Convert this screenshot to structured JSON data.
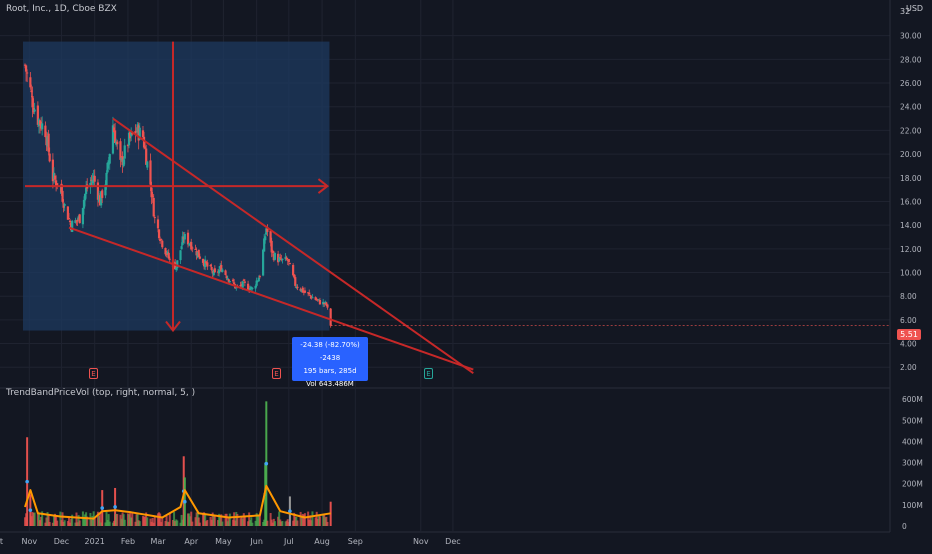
{
  "header": {
    "symbol_title": "Root, Inc., 1D, Cboe BZX",
    "currency": "USD",
    "price_axis_top": "32"
  },
  "indicator": {
    "title": "TrendBandPriceVol (top, right, normal, 5, )"
  },
  "measure_box": {
    "line1": "-24.38 (-82.70%) -2438",
    "line2": "195 bars, 285d",
    "line3": "Vol 643.486M"
  },
  "last_price_label": "5.51",
  "event_markers": [
    "E",
    "E",
    "E"
  ],
  "colors": {
    "background": "#131722",
    "up": "#26a69a",
    "down": "#ef5350",
    "wedge": "#c62828",
    "range_fill": "#1e3a5f",
    "measure_box": "#2962ff",
    "volume_ma": "#ff9800",
    "volume_up": "#4caf50",
    "volume_down": "#ef5350",
    "volume_neutral": "#9e9e9e",
    "volume_dot": "#42a5f5",
    "grid": "#1f2330"
  },
  "chart_data": [
    {
      "type": "candlestick",
      "title": "Root, Inc., 1D, Cboe BZX",
      "x_ticks": [
        "Nov",
        "Dec",
        "2021",
        "Feb",
        "Mar",
        "Apr",
        "May",
        "Jun",
        "Jul",
        "Aug",
        "Sep",
        "Oct",
        "Nov",
        "Dec"
      ],
      "y_ticks": [
        "2.00",
        "4.00",
        "6.00",
        "8.00",
        "10.00",
        "12.00",
        "14.00",
        "16.00",
        "18.00",
        "20.00",
        "22.00",
        "24.00",
        "26.00",
        "28.00",
        "30.00"
      ],
      "ylim": [
        0.5,
        32
      ],
      "grid": true,
      "price_anchors": [
        [
          "Oct 28",
          27.5
        ],
        [
          "Nov 4",
          24.5
        ],
        [
          "Nov 9",
          23.0
        ],
        [
          "Nov 16",
          22.0
        ],
        [
          "Nov 23",
          18.0
        ],
        [
          "Nov 30",
          17.2
        ],
        [
          "Dec 4",
          15.6
        ],
        [
          "Dec 10",
          14.0
        ],
        [
          "Dec 18",
          14.6
        ],
        [
          "Dec 24",
          17.0
        ],
        [
          "Dec 31",
          18.0
        ],
        [
          "Jan 6",
          16.0
        ],
        [
          "Jan 12",
          18.0
        ],
        [
          "Jan 18",
          22.5
        ],
        [
          "Jan 25",
          19.0
        ],
        [
          "Feb 1",
          21.0
        ],
        [
          "Feb 9",
          22.0
        ],
        [
          "Feb 15",
          21.5
        ],
        [
          "Feb 22",
          17.5
        ],
        [
          "Feb 26",
          14.5
        ],
        [
          "Mar 5",
          12.5
        ],
        [
          "Mar 12",
          11.0
        ],
        [
          "Mar 18",
          10.5
        ],
        [
          "Mar 25",
          13.0
        ],
        [
          "Mar 31",
          12.5
        ],
        [
          "Apr 8",
          11.5
        ],
        [
          "Apr 16",
          10.5
        ],
        [
          "Apr 23",
          9.8
        ],
        [
          "Apr 29",
          10.4
        ],
        [
          "May 6",
          9.5
        ],
        [
          "May 13",
          8.7
        ],
        [
          "May 20",
          9.0
        ],
        [
          "May 28",
          8.6
        ],
        [
          "Jun 4",
          9.8
        ],
        [
          "Jun 10",
          13.8
        ],
        [
          "Jun 16",
          11.5
        ],
        [
          "Jun 23",
          11.0
        ],
        [
          "Jun 30",
          11.0
        ],
        [
          "Jul 7",
          9.0
        ],
        [
          "Jul 16",
          8.3
        ],
        [
          "Jul 23",
          7.9
        ],
        [
          "Jul 30",
          7.5
        ],
        [
          "Aug 5",
          7.3
        ],
        [
          "Aug 9",
          5.51
        ]
      ],
      "last_price": 5.51,
      "annotations": {
        "wedge_upper": [
          [
            "Jan 18",
            23.0
          ],
          [
            "Dec 20",
            1.5
          ]
        ],
        "wedge_lower": [
          [
            "Dec 8",
            13.8
          ],
          [
            "Dec 20",
            1.8
          ]
        ],
        "range_box": {
          "from": "Oct 28",
          "to": "Aug 6",
          "high": 29.5,
          "low": 5.1
        },
        "h_arrow_price": 17.3,
        "v_arrow_date": "Mar 15"
      }
    },
    {
      "type": "bar",
      "title": "TrendBandPriceVol (top, right, normal, 5, )",
      "y_ticks": [
        "0",
        "100M",
        "200M",
        "300M",
        "400M",
        "500M",
        "600M"
      ],
      "ylim": [
        0,
        620
      ],
      "volume_spikes_M": [
        [
          "Oct 30",
          420
        ],
        [
          "Nov 2",
          150
        ],
        [
          "Jan 8",
          170
        ],
        [
          "Jan 20",
          180
        ],
        [
          "Feb 4",
          40
        ],
        [
          "Mar 25",
          330
        ],
        [
          "Mar 26",
          230
        ],
        [
          "Jun 10",
          590
        ],
        [
          "Jun 9",
          300
        ],
        [
          "Jul 2",
          140
        ],
        [
          "Aug 9",
          115
        ]
      ],
      "volume_ma_points_M": [
        [
          "Oct 28",
          90
        ],
        [
          "Nov 2",
          170
        ],
        [
          "Nov 9",
          60
        ],
        [
          "Nov 30",
          45
        ],
        [
          "Dec 31",
          35
        ],
        [
          "Jan 8",
          70
        ],
        [
          "Jan 20",
          75
        ],
        [
          "Feb 4",
          65
        ],
        [
          "Mar 5",
          40
        ],
        [
          "Mar 22",
          90
        ],
        [
          "Mar 26",
          170
        ],
        [
          "Apr 8",
          60
        ],
        [
          "May 6",
          40
        ],
        [
          "Jun 4",
          50
        ],
        [
          "Jun 10",
          190
        ],
        [
          "Jun 23",
          70
        ],
        [
          "Jul 16",
          40
        ],
        [
          "Aug 9",
          60
        ]
      ]
    }
  ]
}
